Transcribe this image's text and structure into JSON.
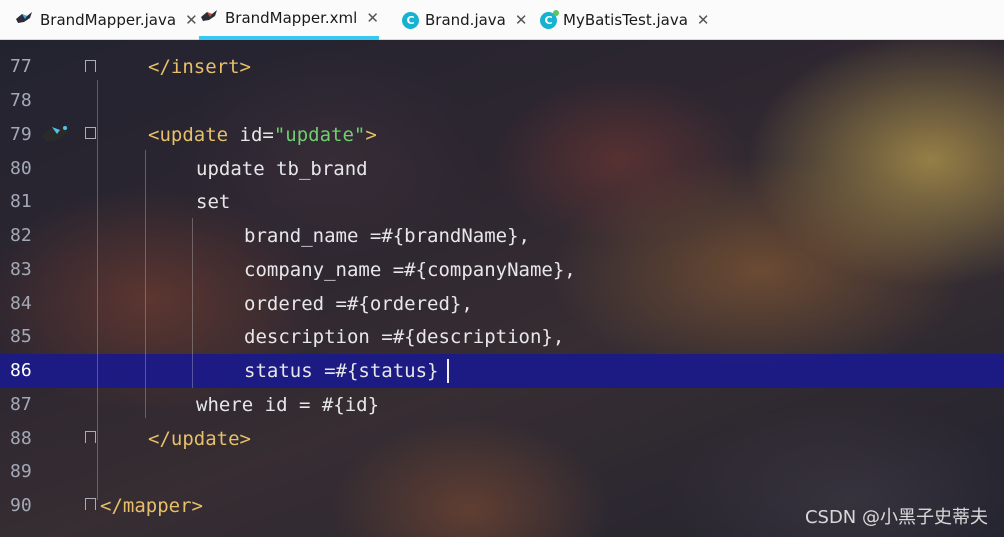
{
  "tabs": [
    {
      "label": "BrandMapper.java",
      "icon": "mapper-java-icon",
      "active": false
    },
    {
      "label": "BrandMapper.xml",
      "icon": "mapper-xml-icon",
      "active": true
    },
    {
      "label": "Brand.java",
      "icon": "class-c-icon",
      "active": false
    },
    {
      "label": "MyBatisTest.java",
      "icon": "class-c-icon",
      "active": false
    }
  ],
  "tab_close_glyph": "✕",
  "editor": {
    "lines": [
      {
        "num": "77",
        "text": "</insert>"
      },
      {
        "num": "78",
        "text": ""
      },
      {
        "num": "79",
        "tag_open": "<update",
        "attr": " id=",
        "value": "\"update\"",
        "tag_close": ">"
      },
      {
        "num": "80",
        "text": "update tb_brand"
      },
      {
        "num": "81",
        "text": "set"
      },
      {
        "num": "82",
        "text": "brand_name =#{brandName},"
      },
      {
        "num": "83",
        "text": "company_name =#{companyName},"
      },
      {
        "num": "84",
        "text": "ordered =#{ordered},"
      },
      {
        "num": "85",
        "text": "description =#{description},"
      },
      {
        "num": "86",
        "text": "status =#{status}"
      },
      {
        "num": "87",
        "text": "where id = #{id}"
      },
      {
        "num": "88",
        "text": "</update>"
      },
      {
        "num": "89",
        "text": ""
      },
      {
        "num": "90",
        "text": "</mapper>"
      }
    ],
    "current_line": "86",
    "colors": {
      "tag": "#e8bf6a",
      "string": "#6fcf6f",
      "highlight": "#1a1a8a",
      "tab_underline": "#39c8f0"
    }
  },
  "watermark": "CSDN @小黑子史蒂夫"
}
